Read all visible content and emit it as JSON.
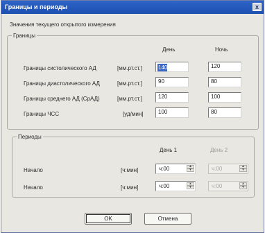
{
  "window": {
    "title": "Границы и периоды",
    "close_glyph": "x"
  },
  "intro_text": "Значения текущего открытого измерения",
  "bounds": {
    "legend": "Границы",
    "col_day": "День",
    "col_night": "Ночь",
    "rows": [
      {
        "label": "Границы систолического АД",
        "unit": "[мм.рт.ст.]",
        "day": "140",
        "night": "120"
      },
      {
        "label": "Границы диастолического АД",
        "unit": "[мм.рт.ст.]",
        "day": "90",
        "night": "80"
      },
      {
        "label": "Границы среднего АД (СрАД)",
        "unit": "[мм.рт.ст.]",
        "day": "120",
        "night": "100"
      },
      {
        "label": "Границы ЧСС",
        "unit": "[уд/мин]",
        "day": "100",
        "night": "80"
      }
    ]
  },
  "periods": {
    "legend": "Периоды",
    "col_day1": "День 1",
    "col_day2": "День 2",
    "rows": [
      {
        "label": "Начало",
        "unit": "[ч:мин]",
        "day1": "ч:00",
        "day2": "ч:00"
      },
      {
        "label": "Начало",
        "unit": "[ч:мин]",
        "day1": "ч:00",
        "day2": "ч:00"
      }
    ]
  },
  "buttons": {
    "ok": "OK",
    "cancel": "Отмена"
  }
}
